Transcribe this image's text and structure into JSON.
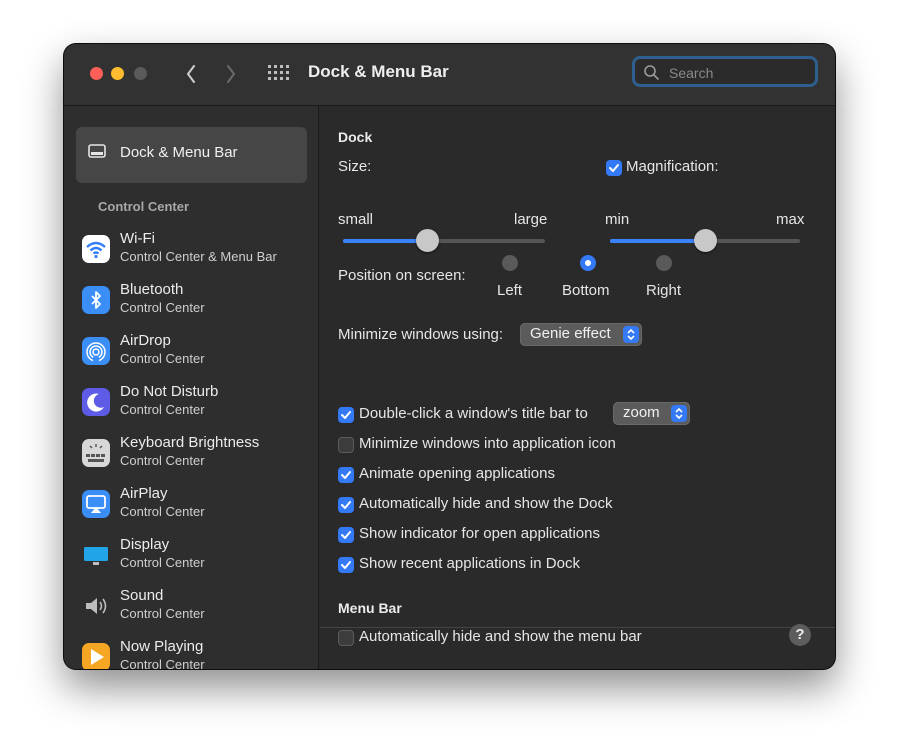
{
  "window": {
    "title": "Dock & Menu Bar",
    "search_placeholder": "Search"
  },
  "sidebar": {
    "selected": {
      "label": "Dock & Menu Bar",
      "icon": "dock-icon"
    },
    "section": "Control Center",
    "items": [
      {
        "name": "Wi-Fi",
        "sub": "Control Center & Menu Bar",
        "icon": "wifi-icon",
        "color": "#ffffff"
      },
      {
        "name": "Bluetooth",
        "sub": "Control Center",
        "icon": "bluetooth-icon",
        "color": "#3a8ef6"
      },
      {
        "name": "AirDrop",
        "sub": "Control Center",
        "icon": "airdrop-icon",
        "color": "#3a8ef6"
      },
      {
        "name": "Do Not Disturb",
        "sub": "Control Center",
        "icon": "moon-icon",
        "color": "#5e5ce6"
      },
      {
        "name": "Keyboard Brightness",
        "sub": "Control Center",
        "icon": "keyboard-brightness-icon",
        "color": "#d8d8d8"
      },
      {
        "name": "AirPlay",
        "sub": "Control Center",
        "icon": "airplay-icon",
        "color": "#3a8ef6"
      },
      {
        "name": "Display",
        "sub": "Control Center",
        "icon": "display-icon",
        "color": "#22a4e8"
      },
      {
        "name": "Sound",
        "sub": "Control Center",
        "icon": "speaker-icon",
        "color": "#bdbdbd"
      },
      {
        "name": "Now Playing",
        "sub": "Control Center",
        "icon": "now-playing-icon",
        "color": "#f5a623"
      }
    ]
  },
  "dock": {
    "heading": "Dock",
    "size_label": "Size:",
    "size_min": "small",
    "size_max": "large",
    "size_value": 0.42,
    "magnification_label": "Magnification:",
    "magnification_checked": true,
    "mag_min": "min",
    "mag_max": "max",
    "mag_value": 0.5,
    "position_label": "Position on screen:",
    "positions": [
      "Left",
      "Bottom",
      "Right"
    ],
    "position_selected": "Bottom",
    "minimize_label": "Minimize windows using:",
    "minimize_effect": "Genie effect",
    "double_click_label": "Double-click a window's title bar to",
    "double_click_action": "zoom",
    "options": [
      {
        "label": "Minimize windows into application icon",
        "checked": false
      },
      {
        "label": "Animate opening applications",
        "checked": true
      },
      {
        "label": "Automatically hide and show the Dock",
        "checked": true
      },
      {
        "label": "Show indicator for open applications",
        "checked": true
      },
      {
        "label": "Show recent applications in Dock",
        "checked": true
      }
    ],
    "double_click_checked": true
  },
  "menubar": {
    "heading": "Menu Bar",
    "autohide_label": "Automatically hide and show the menu bar",
    "autohide_checked": false
  },
  "help": "?",
  "colors": {
    "accent": "#3479f6",
    "background": "#2a2a2a"
  }
}
